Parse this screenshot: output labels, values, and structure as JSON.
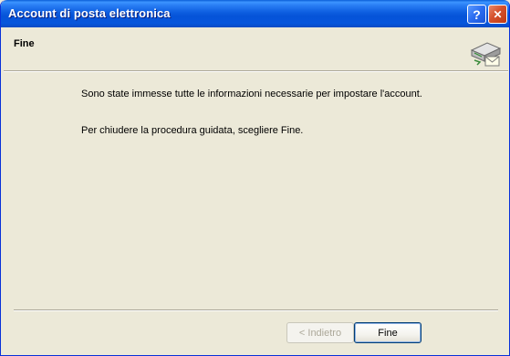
{
  "window": {
    "title": "Account di posta elettronica",
    "help_button": "?",
    "close_button": "✕"
  },
  "header": {
    "title": "Fine",
    "icon": "mail-server-icon"
  },
  "content": {
    "line1": "Sono state immesse tutte le informazioni necessarie per impostare l'account.",
    "line2": "Per chiudere la procedura guidata, scegliere Fine."
  },
  "footer": {
    "back_label": "< Indietro",
    "back_enabled": false,
    "finish_label": "Fine"
  },
  "colors": {
    "titlebar": "#0553d8",
    "face": "#ece9d8",
    "disabled_text": "#aca899"
  }
}
